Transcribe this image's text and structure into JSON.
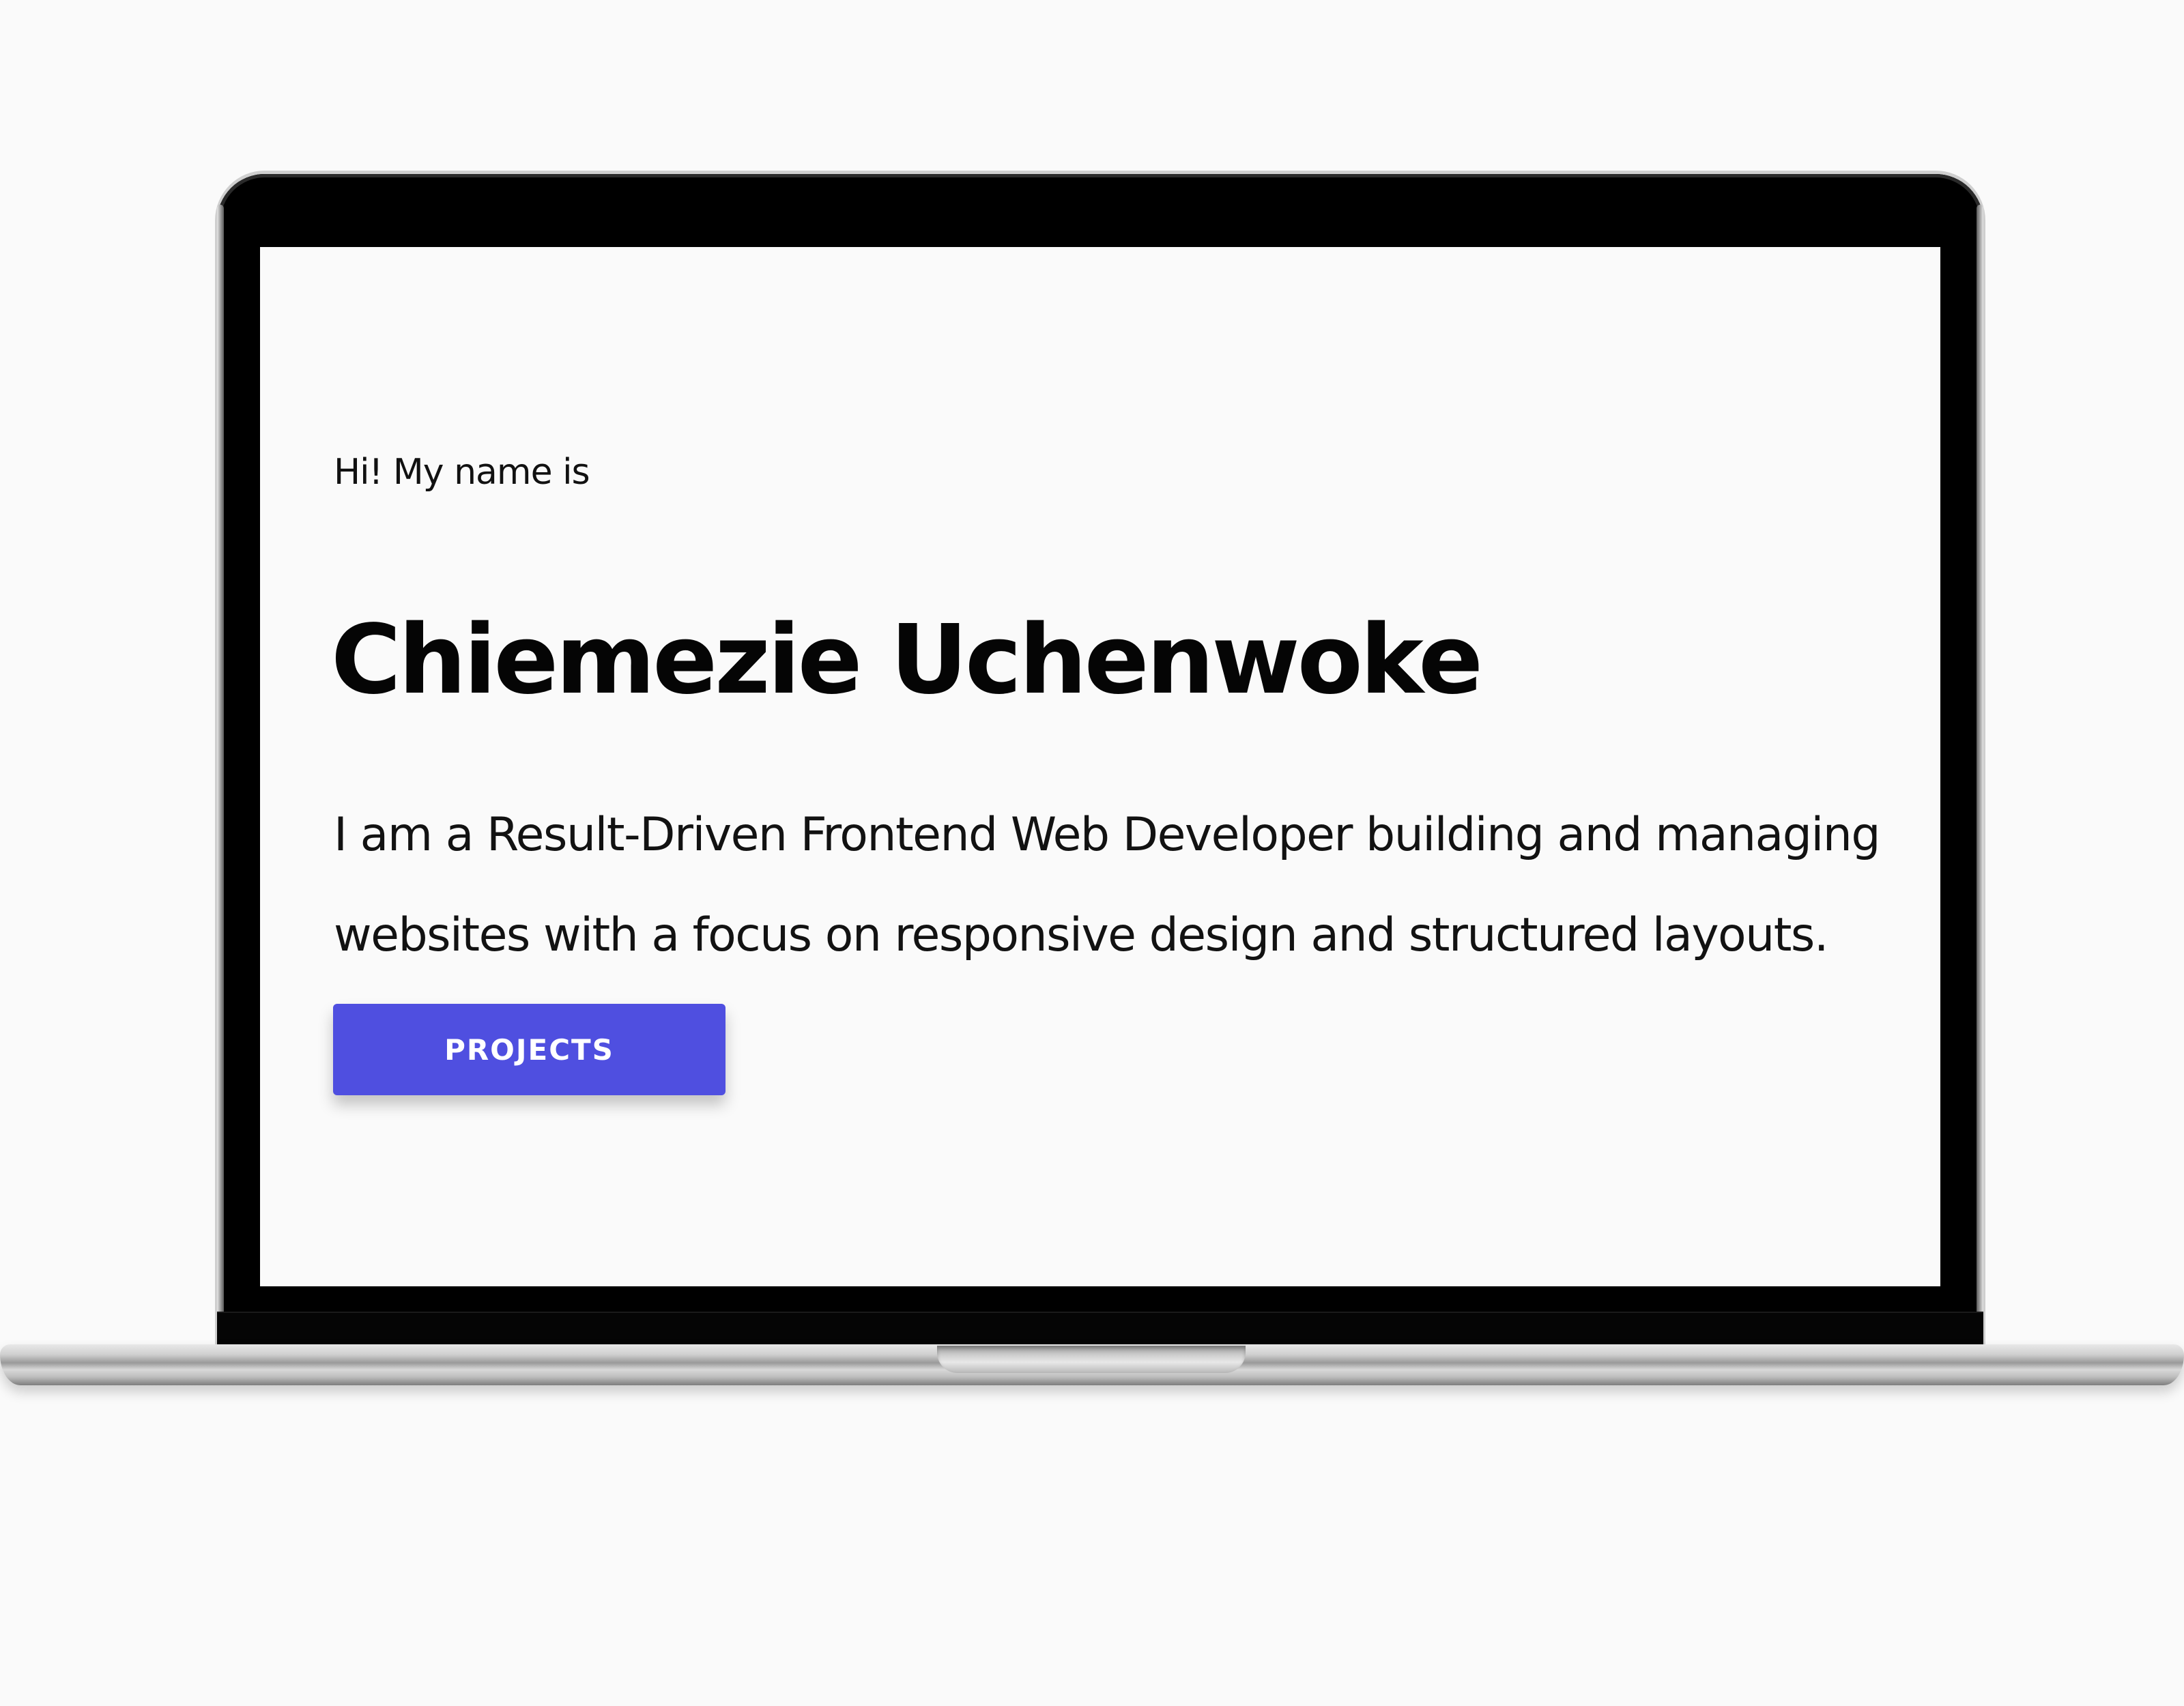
{
  "hero": {
    "greeting": "Hi! My name is",
    "name": "Chiemezie Uchenwoke",
    "bio": "I am a Result-Driven Frontend Web Developer building and managing websites with a focus on responsive design and structured layouts.",
    "projects_button_label": "PROJECTS"
  },
  "colors": {
    "accent": "#4f4fe0",
    "page_background": "#fafafa",
    "text": "#050505",
    "bezel": "#000000"
  }
}
